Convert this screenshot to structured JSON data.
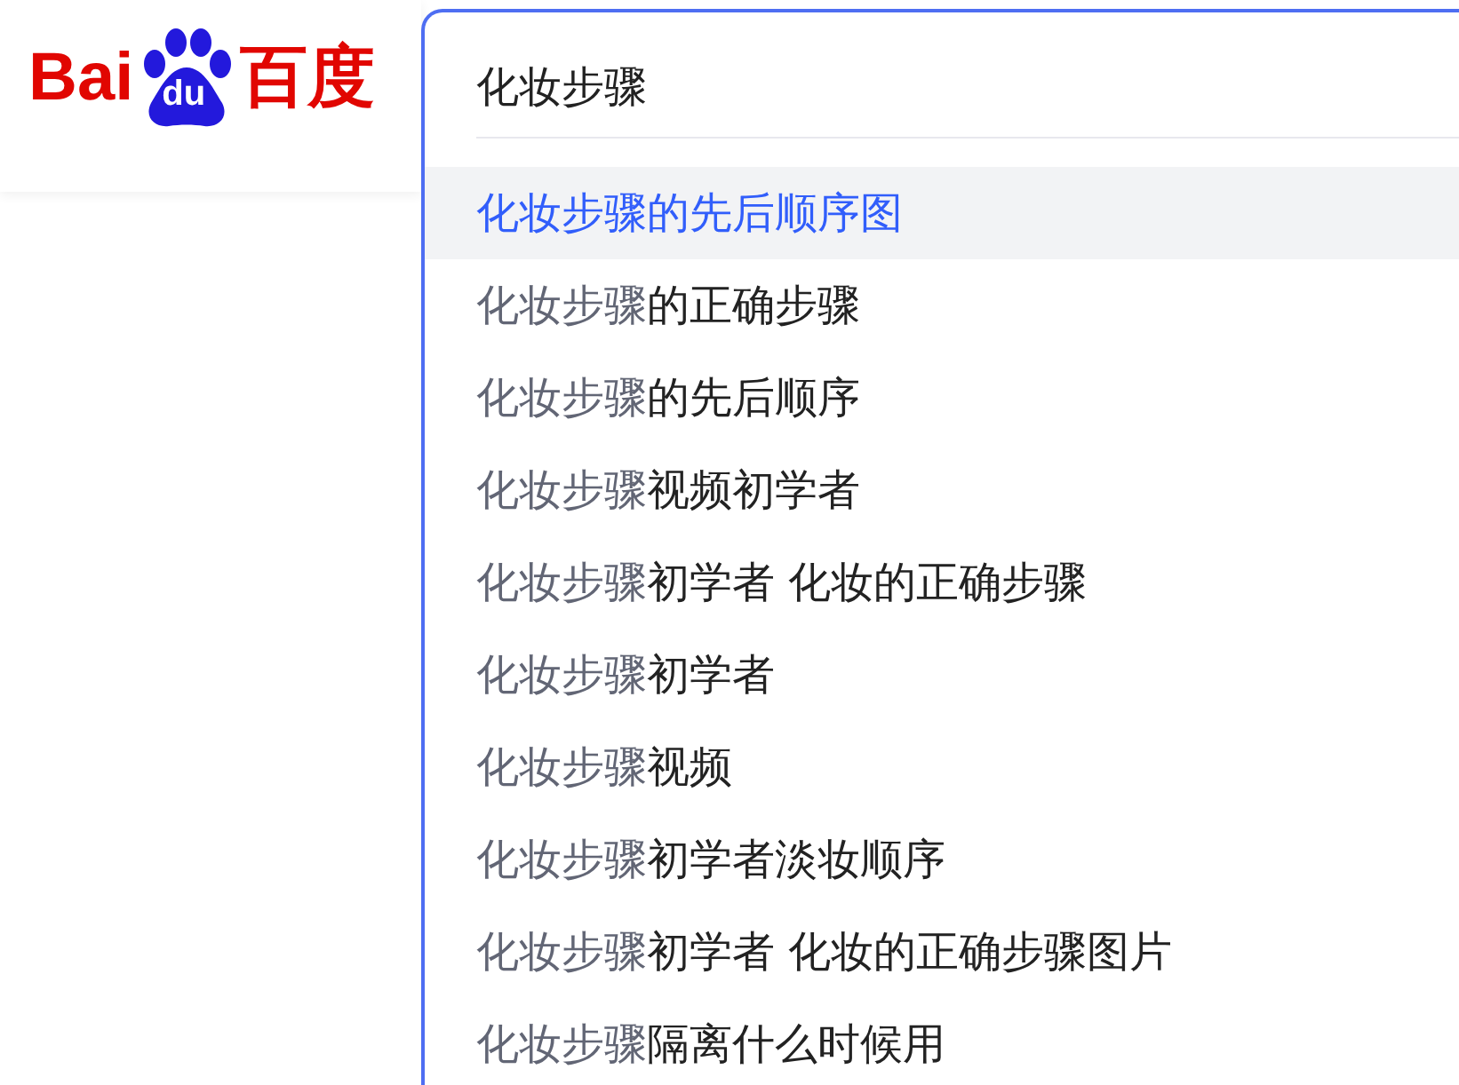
{
  "logo": {
    "left": "Bai",
    "paw": "du",
    "right": "百度"
  },
  "search": {
    "value": "化妆步骤"
  },
  "suggestions": [
    {
      "match": "化妆步骤",
      "rest": "的先后顺序图",
      "selected": true
    },
    {
      "match": "化妆步骤",
      "rest": "的正确步骤",
      "selected": false
    },
    {
      "match": "化妆步骤",
      "rest": "的先后顺序",
      "selected": false
    },
    {
      "match": "化妆步骤",
      "rest": "视频初学者",
      "selected": false
    },
    {
      "match": "化妆步骤",
      "rest": "初学者 化妆的正确步骤",
      "selected": false
    },
    {
      "match": "化妆步骤",
      "rest": "初学者",
      "selected": false
    },
    {
      "match": "化妆步骤",
      "rest": "视频",
      "selected": false
    },
    {
      "match": "化妆步骤",
      "rest": "初学者淡妆顺序",
      "selected": false
    },
    {
      "match": "化妆步骤",
      "rest": "初学者 化妆的正确步骤图片",
      "selected": false
    },
    {
      "match": "化妆步骤",
      "rest": "隔离什么时候用",
      "selected": false
    }
  ]
}
